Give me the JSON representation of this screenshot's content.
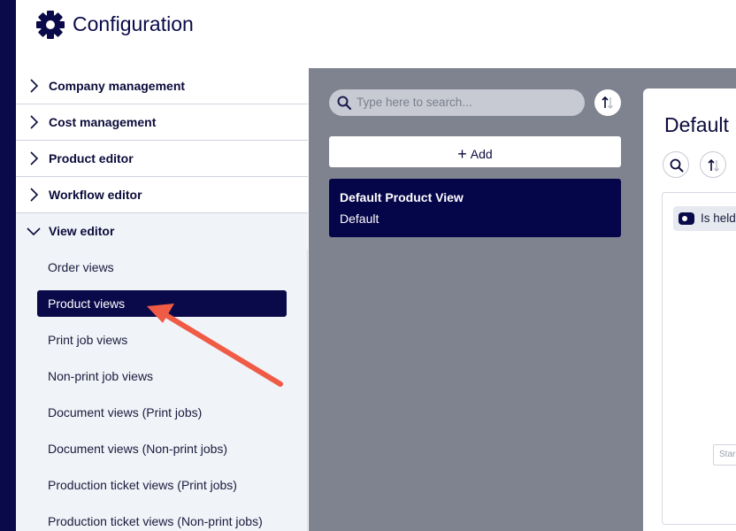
{
  "header": {
    "title": "Configuration"
  },
  "sidebar": {
    "sections": [
      {
        "label": "Company management"
      },
      {
        "label": "Cost management"
      },
      {
        "label": "Product editor"
      },
      {
        "label": "Workflow editor"
      },
      {
        "label": "View editor"
      }
    ],
    "view_editor_items": [
      {
        "label": "Order views"
      },
      {
        "label": "Product views"
      },
      {
        "label": "Print job views"
      },
      {
        "label": "Non-print job views"
      },
      {
        "label": "Document views (Print jobs)"
      },
      {
        "label": "Document views (Non-print jobs)"
      },
      {
        "label": "Production ticket views (Print jobs)"
      },
      {
        "label": "Production ticket views (Non-print jobs)"
      }
    ]
  },
  "middle": {
    "search_placeholder": "Type here to search...",
    "add_label": "Add",
    "card": {
      "title": "Default Product View",
      "subtitle": "Default"
    }
  },
  "detail": {
    "title": "Default",
    "chip_label": "Is held",
    "tiny_label": "Star"
  },
  "colors": {
    "navy": "#0a0a4a",
    "panel_gray": "#7f828f",
    "highlight_arrow": "#ef5b45"
  }
}
